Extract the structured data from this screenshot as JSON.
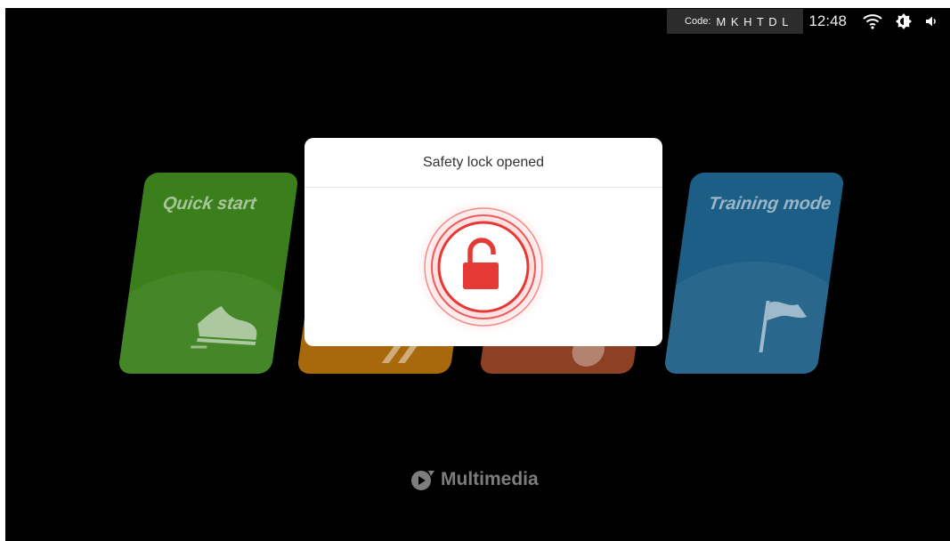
{
  "status_bar": {
    "code_label": "Code:",
    "code_value": "M K H T D L",
    "time": "12:48",
    "icons": [
      "wifi-icon",
      "brightness-icon",
      "volume-icon"
    ]
  },
  "cards": [
    {
      "id": "quick-start",
      "label": "Quick start",
      "icon": "sneaker-icon",
      "color": "#3a7f1c"
    },
    {
      "id": "program",
      "label": "",
      "icon": "runner-icon",
      "color": "#a8690d"
    },
    {
      "id": "target",
      "label": "",
      "icon": "target-icon",
      "color": "#8d4124"
    },
    {
      "id": "training-mode",
      "label": "Training mode",
      "icon": "flag-icon",
      "color": "#1c5e86"
    }
  ],
  "multimedia": {
    "label": "Multimedia",
    "icon": "multimedia-play-icon"
  },
  "dialog": {
    "title": "Safety lock opened",
    "icon": "unlocked-padlock-icon",
    "accent_color": "#e53935"
  }
}
